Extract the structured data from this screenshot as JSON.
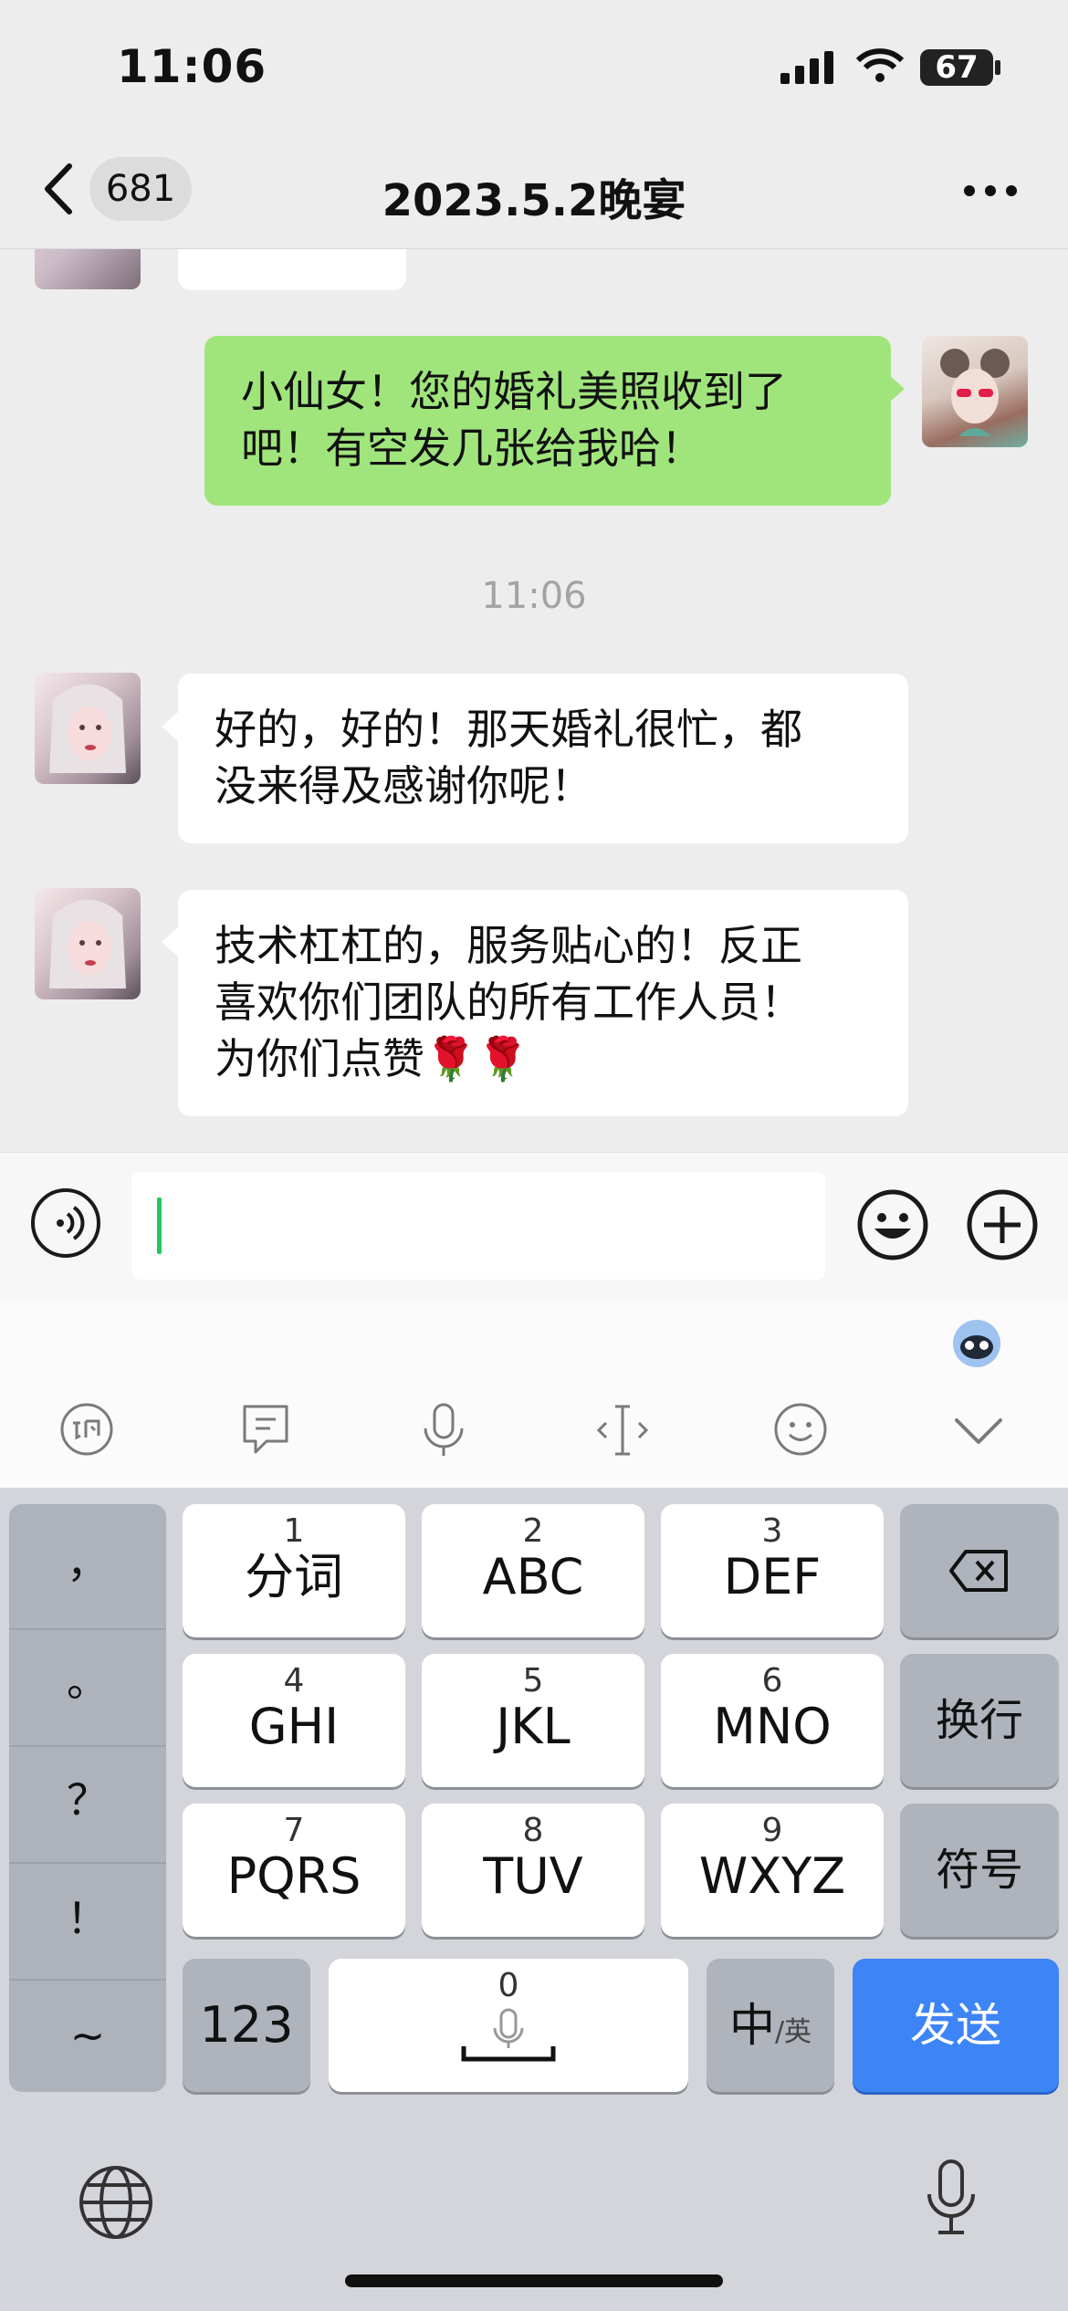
{
  "status_bar": {
    "time": "11:06",
    "battery": "67"
  },
  "nav": {
    "back_count": "681",
    "title": "2023.5.2晚宴",
    "more_icon": "more-dots-icon"
  },
  "messages": [
    {
      "side": "right",
      "text_lines": [
        "小仙女！您的婚礼美照收到了",
        "吧！有空发几张给我哈！"
      ]
    },
    {
      "side": "left",
      "text_lines": [
        "好的，好的！那天婚礼很忙，都",
        "没来得及感谢你呢！"
      ]
    },
    {
      "side": "left",
      "text_lines": [
        "技术杠杠的，服务贴心的！反正",
        "喜欢你们团队的所有工作人员！",
        "为你们点赞🌹🌹"
      ]
    }
  ],
  "timestamp": "11:06",
  "input": {
    "value": "",
    "placeholder": ""
  },
  "keyboard": {
    "side_keys": [
      "，",
      "。",
      "？",
      "！",
      "~"
    ],
    "rows": [
      [
        {
          "num": "1",
          "label": "分词"
        },
        {
          "num": "2",
          "label": "ABC"
        },
        {
          "num": "3",
          "label": "DEF"
        }
      ],
      [
        {
          "num": "4",
          "label": "GHI"
        },
        {
          "num": "5",
          "label": "JKL"
        },
        {
          "num": "6",
          "label": "MNO"
        }
      ],
      [
        {
          "num": "7",
          "label": "PQRS"
        },
        {
          "num": "8",
          "label": "TUV"
        },
        {
          "num": "9",
          "label": "WXYZ"
        }
      ]
    ],
    "newline": "换行",
    "symbols": "符号",
    "num_mode": "123",
    "space_num": "0",
    "lang_main": "中",
    "lang_sub": "/英",
    "send": "发送"
  },
  "colors": {
    "green_bubble": "#a0e57c",
    "send_blue": "#3d84f6",
    "bg": "#ededed"
  }
}
